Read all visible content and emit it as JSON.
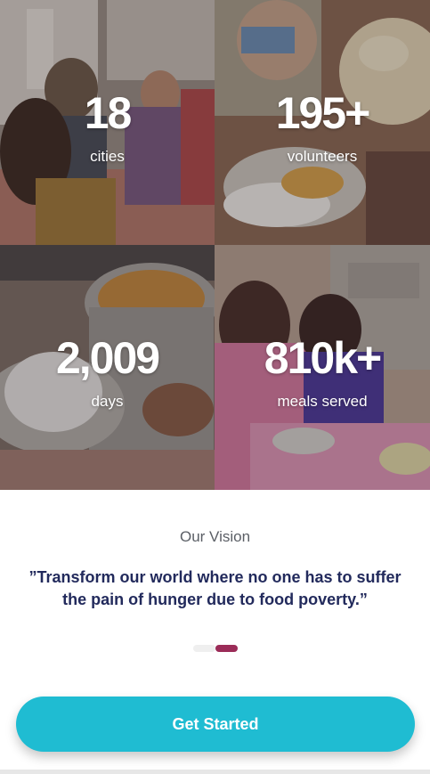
{
  "stats": [
    {
      "value": "18",
      "label": "cities"
    },
    {
      "value": "195+",
      "label": "volunteers"
    },
    {
      "value": "2,009",
      "label": "days"
    },
    {
      "value": "810k+",
      "label": "meals served"
    }
  ],
  "vision": {
    "title": "Our Vision",
    "quote": "”Transform our world where no one has to suffer the pain of hunger due to food poverty.”"
  },
  "carousel": {
    "pages": 2,
    "current": 2
  },
  "cta": {
    "label": "Get Started"
  },
  "colors": {
    "accent": "#1fbcd2",
    "quote_text": "#222a5c",
    "active_dot": "#9b2c58"
  }
}
